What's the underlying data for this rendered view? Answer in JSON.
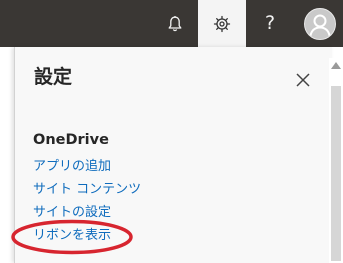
{
  "header": {
    "notification_icon": "bell-icon",
    "settings_icon": "gear-icon",
    "help_label": "?",
    "avatar_icon": "user-avatar-icon",
    "bar_color": "#3a3734",
    "active_button_color": "#f4f4f4"
  },
  "settings_panel": {
    "title": "設定",
    "close_icon": "close-icon",
    "section_title": "OneDrive",
    "links": [
      {
        "label": "アプリの追加"
      },
      {
        "label": "サイト コンテンツ"
      },
      {
        "label": "サイトの設定"
      },
      {
        "label": "リボンを表示"
      }
    ],
    "link_color": "#0f6cbd",
    "highlight_color": "#d7252f"
  }
}
